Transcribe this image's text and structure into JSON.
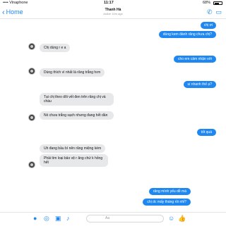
{
  "status_bar": {
    "carrier": "•••• Vinaphone",
    "time": "11:17",
    "battery": "68%",
    "battery_level": 0.68
  },
  "header": {
    "back_label": "Home",
    "contact_name": "Thanh Hà",
    "contact_status": "Active 10m ago"
  },
  "messages": [
    {
      "side": "out",
      "text": "chị ơi"
    },
    {
      "side": "out",
      "text": "dùng kem đánh răng chưa chị?"
    },
    {
      "side": "in",
      "text": "Chị dùng r e a"
    },
    {
      "side": "out",
      "text": "cho em cảm nhận với"
    },
    {
      "side": "in",
      "text": "Dùng thích vì nhất là răng trắng hơn"
    },
    {
      "side": "out",
      "text": "ui nhanh thế ạ?"
    },
    {
      "side": "in",
      "text": "Tại chị theo dõi vết đen trên răng chị và cháu"
    },
    {
      "side": "in",
      "text": "Nó chưa trắng sạch nhưng đang hết dần"
    },
    {
      "side": "out",
      "text": "tốt quá"
    },
    {
      "side": "in",
      "text": "Uh đang bầu bí nên răng miệng kém"
    },
    {
      "side": "in",
      "text": "Phải tìm loại bảo vệ r ăng chứ k hỏng hết"
    },
    {
      "side": "out",
      "text": "răng mình yếu dễ mà"
    },
    {
      "side": "out",
      "text": "chị dc mấy tháng rồi nhỉ?"
    }
  ],
  "composer": {
    "placeholder": "Aa"
  },
  "colors": {
    "accent": "#1e87f0",
    "incoming_bubble": "#e7e8ea"
  }
}
